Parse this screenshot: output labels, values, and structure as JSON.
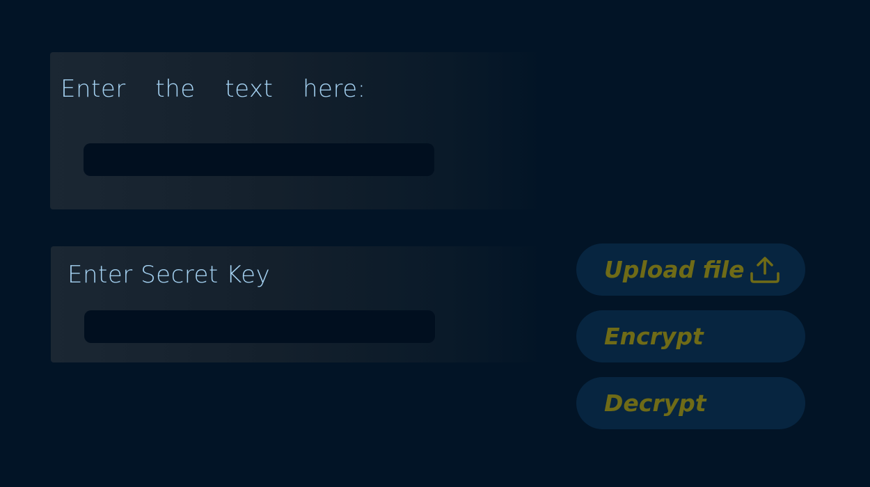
{
  "text_panel": {
    "label": "Enter  the  text  here:",
    "input_value": ""
  },
  "key_panel": {
    "label": "Enter Secret Key",
    "input_value": ""
  },
  "buttons": {
    "upload_label": "Upload file",
    "upload_icon": "upload-icon",
    "encrypt_label": "Encrypt",
    "decrypt_label": "Decrypt"
  },
  "colors": {
    "background": "#021426",
    "label_text": "#a6d3f3",
    "button_bg": "#072540",
    "button_text": "#6f6b17",
    "input_bg": "#010f1f"
  }
}
